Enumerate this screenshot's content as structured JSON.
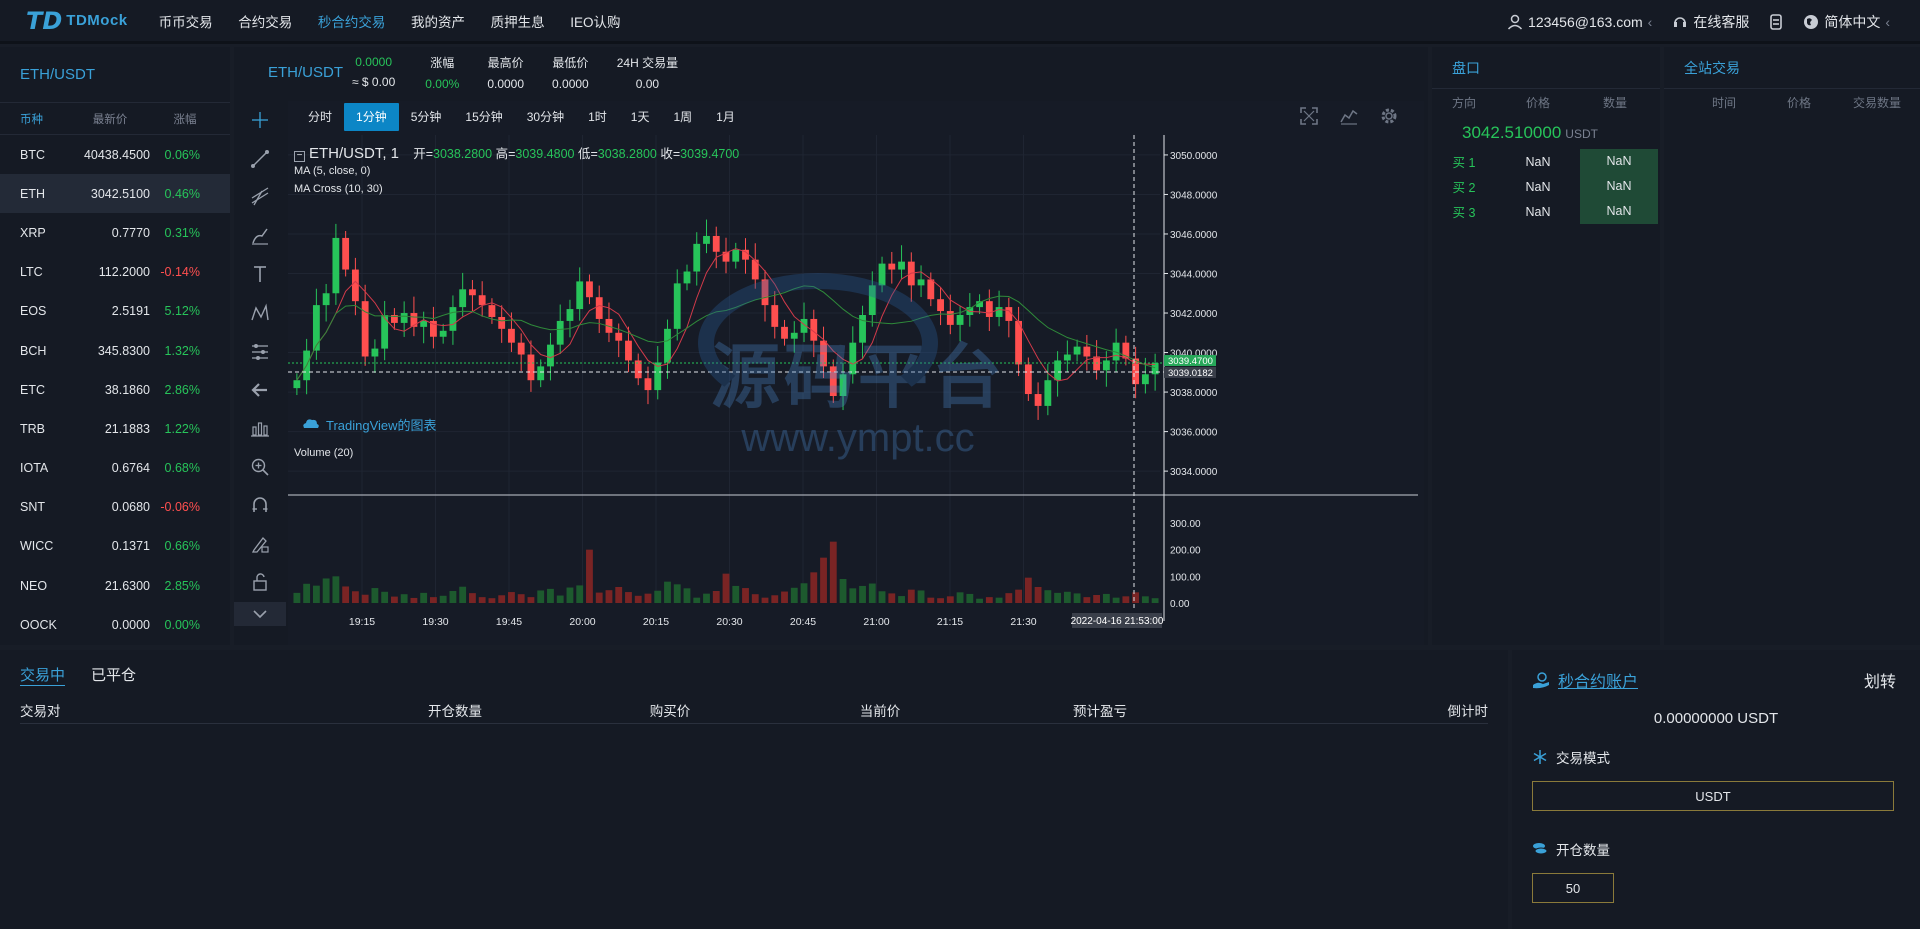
{
  "brand": {
    "mark": "TD",
    "name": "TDMock"
  },
  "nav": [
    "币币交易",
    "合约交易",
    "秒合约交易",
    "我的资产",
    "质押生息",
    "IEO认购"
  ],
  "nav_active": 2,
  "user": {
    "email": "123456@163.com",
    "service": "在线客服",
    "lang": "简体中文"
  },
  "market": {
    "title": "ETH/USDT",
    "headers": [
      "币种",
      "最新价",
      "涨幅"
    ],
    "rows": [
      {
        "sym": "BTC",
        "price": "40438.4500",
        "chg": "0.06%",
        "dir": "up"
      },
      {
        "sym": "ETH",
        "price": "3042.5100",
        "chg": "0.46%",
        "dir": "up"
      },
      {
        "sym": "XRP",
        "price": "0.7770",
        "chg": "0.31%",
        "dir": "up"
      },
      {
        "sym": "LTC",
        "price": "112.2000",
        "chg": "-0.14%",
        "dir": "dn"
      },
      {
        "sym": "EOS",
        "price": "2.5191",
        "chg": "5.12%",
        "dir": "up"
      },
      {
        "sym": "BCH",
        "price": "345.8300",
        "chg": "1.32%",
        "dir": "up"
      },
      {
        "sym": "ETC",
        "price": "38.1860",
        "chg": "2.86%",
        "dir": "up"
      },
      {
        "sym": "TRB",
        "price": "21.1883",
        "chg": "1.22%",
        "dir": "up"
      },
      {
        "sym": "IOTA",
        "price": "0.6764",
        "chg": "0.68%",
        "dir": "up"
      },
      {
        "sym": "SNT",
        "price": "0.0680",
        "chg": "-0.06%",
        "dir": "dn"
      },
      {
        "sym": "WICC",
        "price": "0.1371",
        "chg": "0.66%",
        "dir": "up"
      },
      {
        "sym": "NEO",
        "price": "21.6300",
        "chg": "2.85%",
        "dir": "up"
      },
      {
        "sym": "OOCK",
        "price": "0.0000",
        "chg": "0.00%",
        "dir": "up"
      }
    ]
  },
  "stats": {
    "pair": "ETH/USDT",
    "price": "0.0000",
    "price_usd": "≈ $ 0.00",
    "items": [
      {
        "label": "涨幅",
        "value": "0.00%"
      },
      {
        "label": "最高价",
        "value": "0.0000"
      },
      {
        "label": "最低价",
        "value": "0.0000"
      },
      {
        "label": "24H 交易量",
        "value": "0.00"
      }
    ]
  },
  "timeframes": [
    "分时",
    "1分钟",
    "5分钟",
    "15分钟",
    "30分钟",
    "1时",
    "1天",
    "1周",
    "1月"
  ],
  "chart_overlay": {
    "symbol": "ETH/USDT, 1",
    "ohlc": {
      "open_label": "开=",
      "open": "3038.2800",
      "high_label": "高=",
      "high": "3039.4800",
      "low_label": "低=",
      "low": "3038.2800",
      "close_label": "收=",
      "close": "3039.4700"
    },
    "ma": "MA (5, close, 0)",
    "macross": "MA Cross (10, 30)",
    "tv": "TradingView的图表",
    "volume": "Volume (20)",
    "watermark_cn": "源码平台",
    "watermark_url": "www.ympt.cc"
  },
  "chart_data": {
    "type": "candlestick",
    "x_ticks": [
      "19:15",
      "19:30",
      "19:45",
      "20:00",
      "20:15",
      "20:30",
      "20:45",
      "21:00",
      "21:15",
      "21:30"
    ],
    "y_ticks": [
      "3050.0000",
      "3048.0000",
      "3046.0000",
      "3044.0000",
      "3042.0000",
      "3040.0000",
      "3038.0000",
      "3036.0000",
      "3034.0000"
    ],
    "ylim": [
      3033.5,
      3050.3
    ],
    "vol_ticks": [
      "300.00",
      "200.00",
      "100.00",
      "0.00"
    ],
    "vol_lim": [
      0,
      330
    ],
    "last_price_tag": "3039.4700",
    "cursor_price_tag": "3039.0182",
    "cursor_time": "2022-04-16 21:53:00",
    "colors": {
      "up": "#27c45a",
      "down": "#ff4f4f",
      "ma": "#8a2a9a"
    },
    "closes": [
      3038.6,
      3040.1,
      3042.4,
      3043.0,
      3045.8,
      3044.2,
      3042.6,
      3039.8,
      3040.2,
      3041.9,
      3041.5,
      3042.0,
      3041.3,
      3041.6,
      3040.8,
      3041.1,
      3042.3,
      3043.2,
      3042.9,
      3042.4,
      3041.8,
      3041.2,
      3040.5,
      3039.9,
      3038.6,
      3039.3,
      3040.4,
      3041.6,
      3042.2,
      3043.6,
      3042.8,
      3041.7,
      3041.0,
      3040.6,
      3039.6,
      3038.7,
      3038.1,
      3039.5,
      3041.2,
      3043.5,
      3044.1,
      3045.5,
      3045.9,
      3045.1,
      3044.6,
      3045.2,
      3044.7,
      3043.7,
      3042.4,
      3041.3,
      3040.7,
      3041.0,
      3041.7,
      3040.6,
      3039.3,
      3037.8,
      3038.9,
      3040.5,
      3041.9,
      3043.4,
      3044.5,
      3044.2,
      3044.6,
      3043.4,
      3043.7,
      3042.7,
      3042.1,
      3041.4,
      3041.9,
      3042.3,
      3042.6,
      3041.8,
      3042.3,
      3041.6,
      3039.4,
      3037.9,
      3037.3,
      3038.6,
      3039.6,
      3039.9,
      3040.3,
      3039.8,
      3039.1,
      3039.6,
      3040.5,
      3039.7,
      3038.4,
      3038.9,
      3039.47
    ],
    "volumes": [
      38,
      72,
      65,
      92,
      100,
      62,
      44,
      31,
      56,
      42,
      24,
      33,
      19,
      38,
      22,
      27,
      45,
      61,
      37,
      22,
      18,
      29,
      41,
      33,
      22,
      47,
      53,
      28,
      58,
      66,
      200,
      39,
      48,
      60,
      41,
      27,
      35,
      46,
      80,
      70,
      55,
      20,
      35,
      45,
      110,
      64,
      56,
      33,
      20,
      29,
      43,
      57,
      74,
      115,
      170,
      230,
      90,
      55,
      64,
      73,
      44,
      36,
      26,
      50,
      47,
      20,
      18,
      25,
      40,
      34,
      16,
      22,
      20,
      37,
      50,
      95,
      60,
      48,
      38,
      42,
      36,
      22,
      30,
      34,
      20,
      25,
      40,
      25,
      18
    ]
  },
  "book": {
    "title": "盘口",
    "headers": [
      "方向",
      "价格",
      "数量"
    ],
    "price": "3042.510000",
    "unit": "USDT",
    "rows": [
      {
        "side": "买 1",
        "price": "NaN",
        "qty": "NaN"
      },
      {
        "side": "买 2",
        "price": "NaN",
        "qty": "NaN"
      },
      {
        "side": "买 3",
        "price": "NaN",
        "qty": "NaN"
      }
    ]
  },
  "trades": {
    "title": "全站交易",
    "headers": [
      "时间",
      "价格",
      "交易数量"
    ]
  },
  "orders": {
    "tabs": [
      "交易中",
      "已平仓"
    ],
    "headers": [
      "交易对",
      "开仓数量",
      "购买价",
      "当前价",
      "预计盈亏",
      "倒计时"
    ]
  },
  "account": {
    "title": "秒合约账户",
    "transfer": "划转",
    "balance": "0.00000000 USDT",
    "mode_label": "交易模式",
    "mode_value": "USDT",
    "qty_label": "开仓数量",
    "qty_value": "50"
  }
}
